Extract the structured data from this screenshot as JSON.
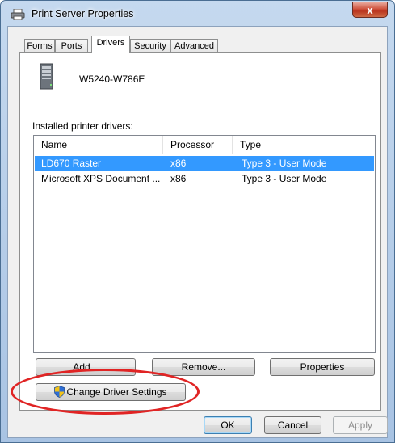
{
  "window": {
    "title": "Print Server Properties",
    "close_glyph": "x"
  },
  "tabs": [
    {
      "label": "Forms"
    },
    {
      "label": "Ports"
    },
    {
      "label": "Drivers"
    },
    {
      "label": "Security"
    },
    {
      "label": "Advanced"
    }
  ],
  "active_tab": "Drivers",
  "server": {
    "name": "W5240-W786E",
    "icon": "server-tower-icon"
  },
  "drivers": {
    "section_label": "Installed printer drivers:",
    "columns": [
      {
        "label": "Name"
      },
      {
        "label": "Processor"
      },
      {
        "label": "Type"
      }
    ],
    "rows": [
      {
        "name": "LD670 Raster",
        "processor": "x86",
        "type": "Type 3 - User Mode",
        "selected": true
      },
      {
        "name": "Microsoft XPS Document ...",
        "processor": "x86",
        "type": "Type 3 - User Mode",
        "selected": false
      }
    ]
  },
  "buttons": {
    "add": "Add...",
    "remove": "Remove...",
    "properties": "Properties",
    "change_driver_settings": "Change Driver Settings",
    "ok": "OK",
    "cancel": "Cancel",
    "apply": "Apply"
  },
  "colors": {
    "selection": "#3399ff",
    "highlight_ellipse": "#e02424"
  }
}
